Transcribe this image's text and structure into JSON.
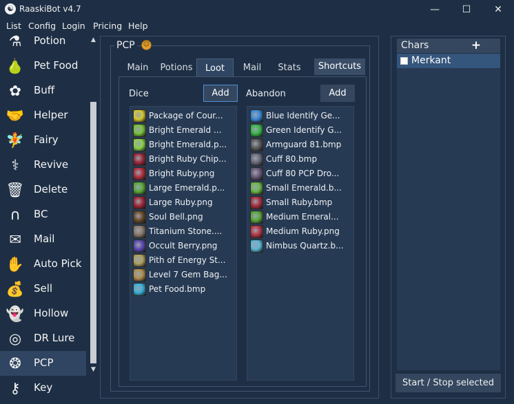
{
  "window": {
    "title": "RaaskiBot v4.7",
    "minimize_glyph": "—",
    "maximize_glyph": "☐",
    "close_glyph": "✕"
  },
  "menu": [
    "List",
    "Config",
    "Login",
    "Pricing",
    "Help"
  ],
  "sidebar": {
    "items": [
      {
        "label": "Potion",
        "icon": "potion-icon",
        "glyph": "⚗"
      },
      {
        "label": "Pet Food",
        "icon": "pet-food-icon",
        "glyph": "🍐"
      },
      {
        "label": "Buff",
        "icon": "buff-icon",
        "glyph": "✿"
      },
      {
        "label": "Helper",
        "icon": "helper-icon",
        "glyph": "🤝"
      },
      {
        "label": "Fairy",
        "icon": "fairy-icon",
        "glyph": "🧚"
      },
      {
        "label": "Revive",
        "icon": "revive-icon",
        "glyph": "⚕"
      },
      {
        "label": "Delete",
        "icon": "delete-icon",
        "glyph": "🗑"
      },
      {
        "label": "BC",
        "icon": "bc-icon",
        "glyph": "∩"
      },
      {
        "label": "Mail",
        "icon": "mail-icon",
        "glyph": "✉"
      },
      {
        "label": "Auto Pick",
        "icon": "auto-pick-icon",
        "glyph": "✋"
      },
      {
        "label": "Sell",
        "icon": "sell-icon",
        "glyph": "💰"
      },
      {
        "label": "Hollow",
        "icon": "hollow-icon",
        "glyph": "👻"
      },
      {
        "label": "DR Lure",
        "icon": "dr-lure-icon",
        "glyph": "◎"
      },
      {
        "label": "PCP",
        "icon": "pcp-icon",
        "glyph": "❂",
        "active": true
      },
      {
        "label": "Key",
        "icon": "key-icon",
        "glyph": "⚷"
      }
    ],
    "scroll_up": "▲",
    "scroll_down": "▼"
  },
  "pcp": {
    "title": "PCP",
    "title_emoji": "☺",
    "tabs": [
      {
        "label": "Main"
      },
      {
        "label": "Potions"
      },
      {
        "label": "Loot",
        "active": true
      },
      {
        "label": "Mail"
      },
      {
        "label": "Stats"
      },
      {
        "label": "Shortcuts"
      }
    ],
    "dice": {
      "label": "Dice",
      "add_label": "Add",
      "items": [
        {
          "text": "Package of Cour...",
          "color": "#d8c832"
        },
        {
          "text": "Bright Emerald ...",
          "color": "#7ac23a"
        },
        {
          "text": "Bright Emerald.p...",
          "color": "#8cd24a"
        },
        {
          "text": "Bright Ruby Chip...",
          "color": "#9a2a3a"
        },
        {
          "text": "Bright Ruby.png",
          "color": "#b03040"
        },
        {
          "text": "Large Emerald.p...",
          "color": "#5aa83a"
        },
        {
          "text": "Large Ruby.png",
          "color": "#a02838"
        },
        {
          "text": "Soul Bell.png",
          "color": "#6a4a2a"
        },
        {
          "text": "Titanium Stone....",
          "color": "#8a7a6a"
        },
        {
          "text": "Occult Berry.png",
          "color": "#5a4ab0"
        },
        {
          "text": "Pith of Energy St...",
          "color": "#b0a060"
        },
        {
          "text": "Level 7 Gem Bag...",
          "color": "#b09050"
        },
        {
          "text": "Pet Food.bmp",
          "color": "#3ab0d8"
        }
      ]
    },
    "abandon": {
      "label": "Abandon",
      "add_label": "Add",
      "items": [
        {
          "text": "Blue Identify Ge...",
          "color": "#3a8ad8"
        },
        {
          "text": "Green Identify G...",
          "color": "#3ab84a"
        },
        {
          "text": "Armguard 81.bmp",
          "color": "#5a5a5a"
        },
        {
          "text": "Cuff 80.bmp",
          "color": "#6a6a7a"
        },
        {
          "text": "Cuff 80 PCP Dro...",
          "color": "#6a5a7a"
        },
        {
          "text": "Small Emerald.b...",
          "color": "#6ab84a"
        },
        {
          "text": "Small Ruby.bmp",
          "color": "#a83040"
        },
        {
          "text": "Medium Emeral...",
          "color": "#5aa83a"
        },
        {
          "text": "Medium Ruby.png",
          "color": "#b83848"
        },
        {
          "text": "Nimbus Quartz.b...",
          "color": "#5ab8d8"
        }
      ]
    }
  },
  "chars": {
    "title": "Chars",
    "add_glyph": "+",
    "items": [
      {
        "name": "Merkant",
        "checked": false,
        "selected": true
      }
    ],
    "start_stop_label": "Start / Stop selected"
  }
}
